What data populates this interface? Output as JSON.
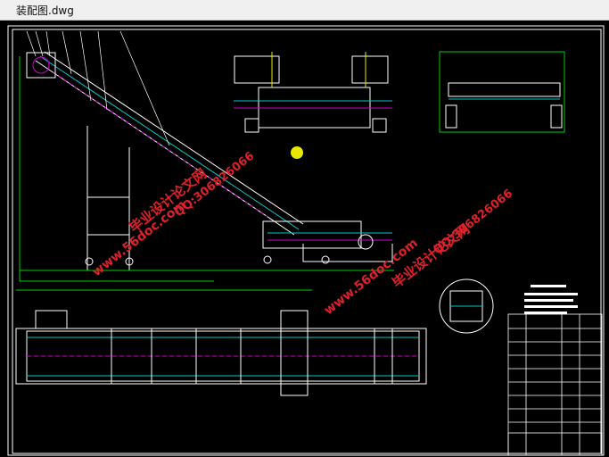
{
  "window": {
    "title": "装配图.dwg"
  },
  "watermarks": [
    {
      "text": "毕业设计论文网",
      "color": "#e0202a"
    },
    {
      "text": "www.56doc.com",
      "color": "#e0202a"
    },
    {
      "text": "QQ:306826066",
      "color": "#e0202a"
    },
    {
      "text": "www.56doc.com",
      "color": "#e0202a"
    },
    {
      "text": "QQ:306826066",
      "color": "#e0202a"
    },
    {
      "text": "毕业设计论文网",
      "color": "#e0202a"
    }
  ],
  "colors": {
    "background": "#000000",
    "frame": "#ffffff",
    "green": "#00d000",
    "cyan": "#00c8c8",
    "magenta": "#d000d0",
    "yellow": "#e8e800",
    "red": "#e0202a"
  }
}
